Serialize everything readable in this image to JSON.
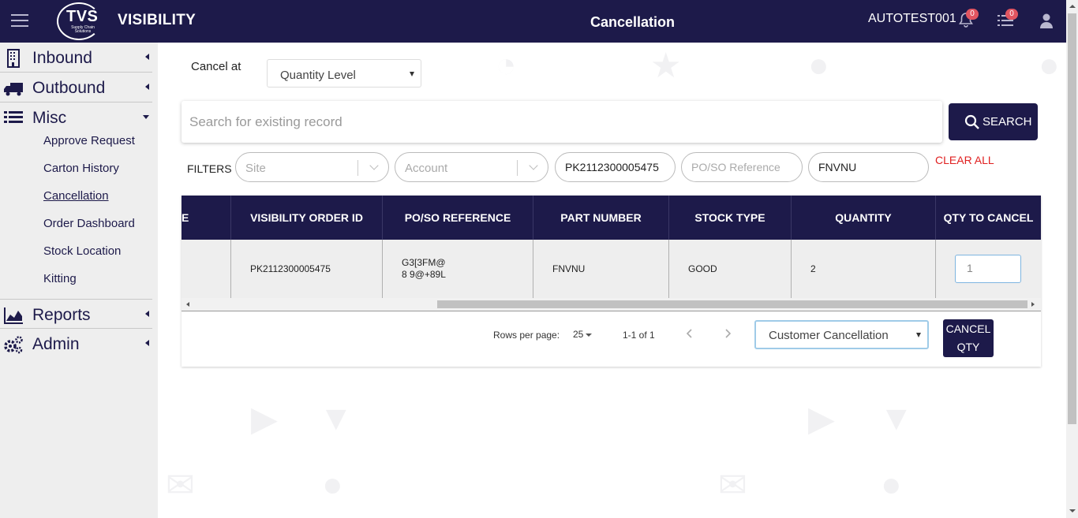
{
  "header": {
    "logo_main": "TVS",
    "logo_sub": "Supply Chain Solutions",
    "app_name": "VISIBILITY",
    "page_title": "Cancellation",
    "username": "AUTOTEST001",
    "notifications_count": "0",
    "tasks_count": "0",
    "colors": {
      "bar": "#1d1a4a",
      "badge": "#e05561"
    }
  },
  "sidebar": {
    "sections": [
      {
        "label": "Inbound",
        "icon": "building-icon"
      },
      {
        "label": "Outbound",
        "icon": "truck-icon"
      },
      {
        "label": "Misc",
        "icon": "list-icon"
      },
      {
        "label": "Reports",
        "icon": "area-chart-icon"
      },
      {
        "label": "Admin",
        "icon": "gears-icon"
      }
    ],
    "misc_items": [
      {
        "label": "Approve Request"
      },
      {
        "label": "Carton History"
      },
      {
        "label": "Cancellation",
        "active": true
      },
      {
        "label": "Order Dashboard"
      },
      {
        "label": "Stock Location"
      },
      {
        "label": "Kitting"
      }
    ]
  },
  "cancel_at": {
    "label": "Cancel at",
    "value": "Quantity Level"
  },
  "search": {
    "placeholder": "Search for existing record",
    "button_label": "SEARCH"
  },
  "filters": {
    "label": "FILTERS",
    "site_placeholder": "Site",
    "account_placeholder": "Account",
    "order_id": "PK2112300005475",
    "po_so_placeholder": "PO/SO Reference",
    "part_number": "FNVNU",
    "clear_all_label": "CLEAR ALL"
  },
  "table": {
    "columns": [
      "E",
      "VISIBILITY ORDER ID",
      "PO/SO REFERENCE",
      "PART NUMBER",
      "STOCK TYPE",
      "QUANTITY",
      "QTY TO CANCEL"
    ],
    "rows": [
      {
        "order_id": "PK2112300005475",
        "po_so_reference": "G3[3FM@8 9@+89L",
        "part_number": "FNVNU",
        "stock_type": "GOOD",
        "quantity": "2",
        "qty_to_cancel": "1"
      }
    ]
  },
  "pagination": {
    "rows_per_page_label": "Rows per page:",
    "rows_per_page": "25",
    "range": "1-1 of 1"
  },
  "cancellation_type": {
    "value": "Customer Cancellation"
  },
  "cancel_qty_button": {
    "line1": "CANCEL",
    "line2": "QTY"
  }
}
